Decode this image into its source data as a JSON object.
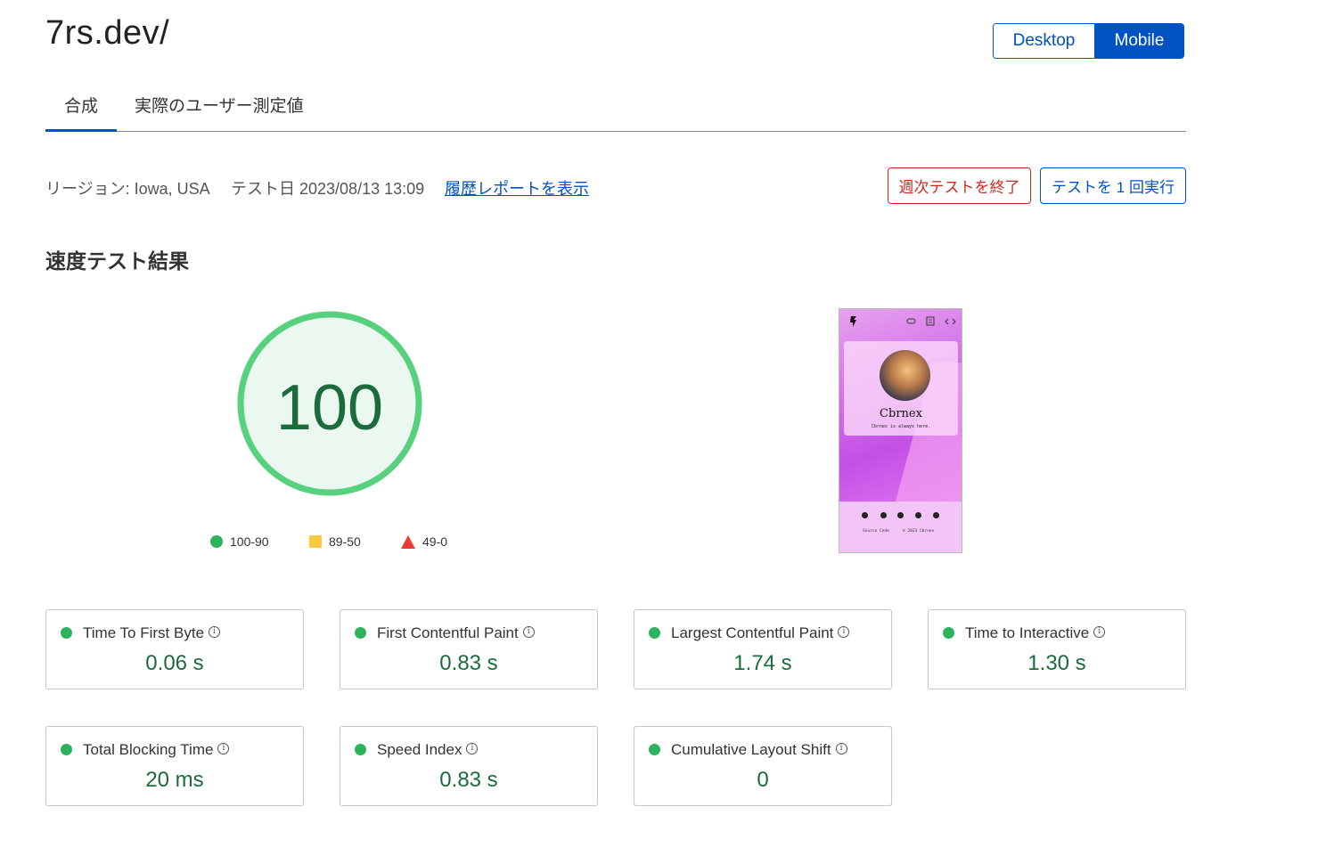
{
  "header": {
    "site_title": "7rs.dev/",
    "device_options": [
      "Desktop",
      "Mobile"
    ],
    "device_selected": "Mobile"
  },
  "tabs": [
    {
      "label": "合成",
      "active": true
    },
    {
      "label": "実際のユーザー測定値",
      "active": false
    }
  ],
  "meta": {
    "region": "リージョン: Iowa, USA",
    "test_date": "テスト日 2023/08/13 13:09",
    "history_link": "履歴レポートを表示",
    "end_weekly_button": "週次テストを終了",
    "run_once_button": "テストを 1 回実行"
  },
  "speed_results": {
    "title": "速度テスト結果",
    "score": "100",
    "legend": [
      {
        "label": "100-90",
        "shape": "circle",
        "color": "#2db35d"
      },
      {
        "label": "89-50",
        "shape": "square",
        "color": "#ffc93d"
      },
      {
        "label": "49-0",
        "shape": "triangle",
        "color": "#e93b32"
      }
    ]
  },
  "preview": {
    "name": "Cbrnex",
    "tagline": "Cbrnex is always here.",
    "footer_left": "Source Code",
    "footer_right": "© 2023 Cbrnex",
    "top_icons": [
      "logo-icon",
      "link-icon",
      "document-icon",
      "code-icon"
    ],
    "social_icons": [
      "youtube-icon",
      "twitter-icon",
      "pinterest-icon",
      "telegram-icon",
      "discord-icon"
    ]
  },
  "metrics": [
    {
      "name": "Time To First Byte",
      "value": "0.06 s"
    },
    {
      "name": "First Contentful Paint",
      "value": "0.83 s"
    },
    {
      "name": "Largest Contentful Paint",
      "value": "1.74 s"
    },
    {
      "name": "Time to Interactive",
      "value": "1.30 s"
    },
    {
      "name": "Total Blocking Time",
      "value": "20 ms"
    },
    {
      "name": "Speed Index",
      "value": "0.83 s"
    },
    {
      "name": "Cumulative Layout Shift",
      "value": "0"
    }
  ],
  "colors": {
    "accent": "#0051c3",
    "danger": "#d2261f",
    "good": "#2db35d",
    "good_text": "#1c6b3c",
    "gauge_ring": "#58d17f",
    "gauge_fill": "#eaf8ef"
  }
}
